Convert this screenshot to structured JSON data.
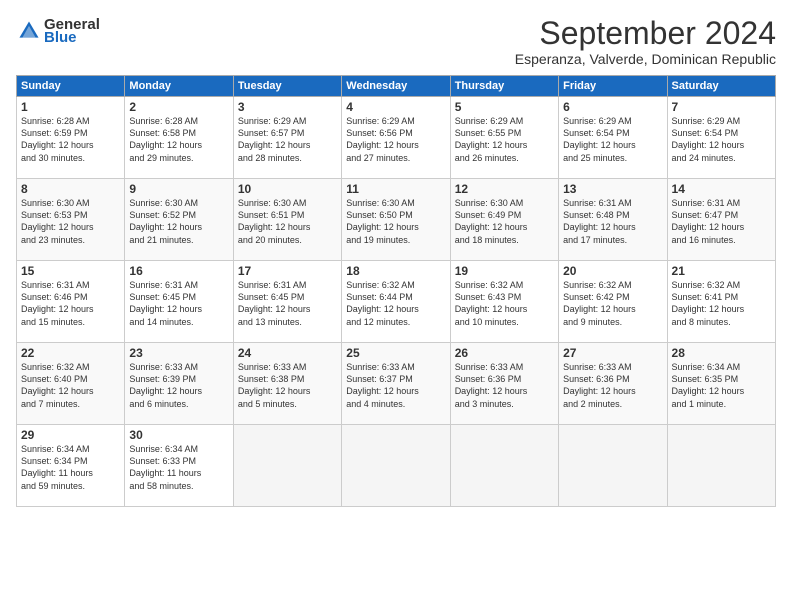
{
  "logo": {
    "general": "General",
    "blue": "Blue"
  },
  "header": {
    "month": "September 2024",
    "location": "Esperanza, Valverde, Dominican Republic"
  },
  "weekdays": [
    "Sunday",
    "Monday",
    "Tuesday",
    "Wednesday",
    "Thursday",
    "Friday",
    "Saturday"
  ],
  "weeks": [
    [
      {
        "day": "1",
        "rise": "6:28 AM",
        "set": "6:59 PM",
        "daylight": "12 hours and 30 minutes."
      },
      {
        "day": "2",
        "rise": "6:28 AM",
        "set": "6:58 PM",
        "daylight": "12 hours and 29 minutes."
      },
      {
        "day": "3",
        "rise": "6:29 AM",
        "set": "6:57 PM",
        "daylight": "12 hours and 28 minutes."
      },
      {
        "day": "4",
        "rise": "6:29 AM",
        "set": "6:56 PM",
        "daylight": "12 hours and 27 minutes."
      },
      {
        "day": "5",
        "rise": "6:29 AM",
        "set": "6:55 PM",
        "daylight": "12 hours and 26 minutes."
      },
      {
        "day": "6",
        "rise": "6:29 AM",
        "set": "6:54 PM",
        "daylight": "12 hours and 25 minutes."
      },
      {
        "day": "7",
        "rise": "6:29 AM",
        "set": "6:54 PM",
        "daylight": "12 hours and 24 minutes."
      }
    ],
    [
      {
        "day": "8",
        "rise": "6:30 AM",
        "set": "6:53 PM",
        "daylight": "12 hours and 23 minutes."
      },
      {
        "day": "9",
        "rise": "6:30 AM",
        "set": "6:52 PM",
        "daylight": "12 hours and 21 minutes."
      },
      {
        "day": "10",
        "rise": "6:30 AM",
        "set": "6:51 PM",
        "daylight": "12 hours and 20 minutes."
      },
      {
        "day": "11",
        "rise": "6:30 AM",
        "set": "6:50 PM",
        "daylight": "12 hours and 19 minutes."
      },
      {
        "day": "12",
        "rise": "6:30 AM",
        "set": "6:49 PM",
        "daylight": "12 hours and 18 minutes."
      },
      {
        "day": "13",
        "rise": "6:31 AM",
        "set": "6:48 PM",
        "daylight": "12 hours and 17 minutes."
      },
      {
        "day": "14",
        "rise": "6:31 AM",
        "set": "6:47 PM",
        "daylight": "12 hours and 16 minutes."
      }
    ],
    [
      {
        "day": "15",
        "rise": "6:31 AM",
        "set": "6:46 PM",
        "daylight": "12 hours and 15 minutes."
      },
      {
        "day": "16",
        "rise": "6:31 AM",
        "set": "6:45 PM",
        "daylight": "12 hours and 14 minutes."
      },
      {
        "day": "17",
        "rise": "6:31 AM",
        "set": "6:45 PM",
        "daylight": "12 hours and 13 minutes."
      },
      {
        "day": "18",
        "rise": "6:32 AM",
        "set": "6:44 PM",
        "daylight": "12 hours and 12 minutes."
      },
      {
        "day": "19",
        "rise": "6:32 AM",
        "set": "6:43 PM",
        "daylight": "12 hours and 10 minutes."
      },
      {
        "day": "20",
        "rise": "6:32 AM",
        "set": "6:42 PM",
        "daylight": "12 hours and 9 minutes."
      },
      {
        "day": "21",
        "rise": "6:32 AM",
        "set": "6:41 PM",
        "daylight": "12 hours and 8 minutes."
      }
    ],
    [
      {
        "day": "22",
        "rise": "6:32 AM",
        "set": "6:40 PM",
        "daylight": "12 hours and 7 minutes."
      },
      {
        "day": "23",
        "rise": "6:33 AM",
        "set": "6:39 PM",
        "daylight": "12 hours and 6 minutes."
      },
      {
        "day": "24",
        "rise": "6:33 AM",
        "set": "6:38 PM",
        "daylight": "12 hours and 5 minutes."
      },
      {
        "day": "25",
        "rise": "6:33 AM",
        "set": "6:37 PM",
        "daylight": "12 hours and 4 minutes."
      },
      {
        "day": "26",
        "rise": "6:33 AM",
        "set": "6:36 PM",
        "daylight": "12 hours and 3 minutes."
      },
      {
        "day": "27",
        "rise": "6:33 AM",
        "set": "6:36 PM",
        "daylight": "12 hours and 2 minutes."
      },
      {
        "day": "28",
        "rise": "6:34 AM",
        "set": "6:35 PM",
        "daylight": "12 hours and 1 minute."
      }
    ],
    [
      {
        "day": "29",
        "rise": "6:34 AM",
        "set": "6:34 PM",
        "daylight": "11 hours and 59 minutes."
      },
      {
        "day": "30",
        "rise": "6:34 AM",
        "set": "6:33 PM",
        "daylight": "11 hours and 58 minutes."
      },
      null,
      null,
      null,
      null,
      null
    ]
  ],
  "labels": {
    "sunrise": "Sunrise:",
    "sunset": "Sunset:",
    "daylight": "Daylight:"
  }
}
